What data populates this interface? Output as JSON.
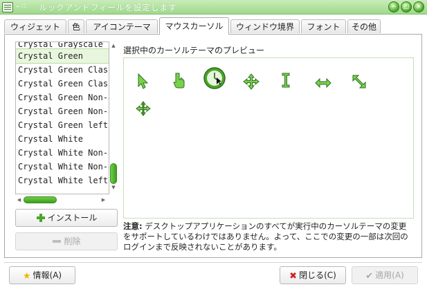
{
  "window": {
    "title": "ルックアンドフィールを設定します",
    "title_dots": "– ∷",
    "controls": [
      "−",
      "▢",
      "×"
    ]
  },
  "tabs": [
    {
      "label": "ウィジェット"
    },
    {
      "label": "色"
    },
    {
      "label": "アイコンテーマ"
    },
    {
      "label": "マウスカーソル",
      "active": true
    },
    {
      "label": "ウィンドウ境界"
    },
    {
      "label": "フォント"
    },
    {
      "label": "その他"
    }
  ],
  "theme_list": {
    "items": [
      "Crystal Grayscale",
      "Crystal Green",
      "Crystal Green Classic",
      "Crystal Green Classic",
      "Crystal Green Non-a",
      "Crystal Green Non-a",
      "Crystal Green left",
      "Crystal White",
      "Crystal White Non-a",
      "Crystal White Non-a",
      "Crystal White left"
    ],
    "selected_index": 1,
    "vscroll_position": 0.85,
    "hscroll_position": 0.0
  },
  "buttons": {
    "install": "インストール",
    "delete": "削除",
    "info": "情報(A)",
    "close": "閉じる(C)",
    "apply": "適用(A)"
  },
  "preview": {
    "label": "選択中のカーソルテーマのプレビュー",
    "cursors": [
      "arrow-cursor-icon",
      "hand-cursor-icon",
      "busy-clock-cursor-icon",
      "move-cursor-icon",
      "text-ibeam-cursor-icon",
      "resize-horizontal-cursor-icon",
      "resize-diagonal-cursor-icon",
      "split-move-cursor-icon"
    ]
  },
  "note": {
    "prefix": "注意:",
    "text": "デスクトップアプリケーションのすべてが実行中のカーソルテーマの変更をサポートしているわけではありません。よって、ここでの変更の一部は次回のログインまで反映されないことがあります。"
  },
  "colors": {
    "accent_green": "#4aa42c",
    "titlebar": "#9fd98c",
    "selection": "#e9f6de"
  }
}
